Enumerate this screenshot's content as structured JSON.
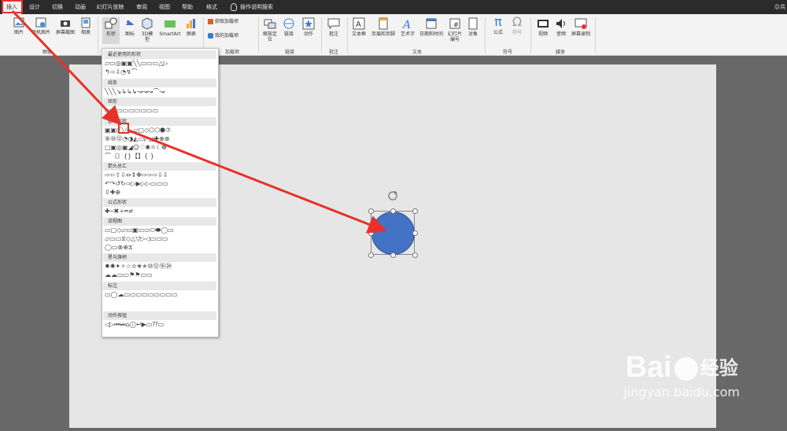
{
  "tabs": [
    {
      "label": "插入",
      "active": true
    },
    {
      "label": "设计"
    },
    {
      "label": "切换"
    },
    {
      "label": "动画"
    },
    {
      "label": "幻灯片放映"
    },
    {
      "label": "审阅"
    },
    {
      "label": "视图"
    },
    {
      "label": "帮助"
    },
    {
      "label": "格式"
    }
  ],
  "tell_me": "操作说明搜索",
  "user_label": "共",
  "ribbon": {
    "images": {
      "picture": "图片",
      "online_picture": "联机图片",
      "screenshot": "屏幕截图",
      "album": "相册",
      "group": "图像"
    },
    "illustrations": {
      "shapes": "形状",
      "icons": "图标",
      "model3d": "3D模型",
      "smartart": "SmartArt",
      "chart": "图表"
    },
    "addins": {
      "get": "获取加载项",
      "my": "我的加载项",
      "group": "加载项"
    },
    "links": {
      "zoom": "缩放定位",
      "link": "链接",
      "action": "动作",
      "group": "链接"
    },
    "comments": {
      "comment": "批注",
      "group": "批注"
    },
    "text": {
      "textbox": "文本框",
      "header_footer": "页眉和页脚",
      "wordart": "艺术字",
      "datetime": "日期和时间",
      "slide_number": "幻灯片编号",
      "object": "对象",
      "group": "文本"
    },
    "symbols": {
      "equation": "公式",
      "symbol": "符号",
      "group": "符号"
    },
    "media": {
      "video": "视频",
      "audio": "音频",
      "screen_recording": "屏幕录制",
      "group": "媒体"
    }
  },
  "gallery": {
    "recent": "最近使用的形状",
    "lines": "线条",
    "rectangles": "矩形",
    "basic": "基本形状",
    "arrows": "箭头总汇",
    "equation": "公式形状",
    "flowchart": "流程图",
    "stars": "星与旗帜",
    "callouts": "标注",
    "action": "动作按钮"
  },
  "shape_fill": "#4472c4",
  "annotation_color": "#e8312a",
  "watermark": {
    "brand": "Bai",
    "brand2": "经验",
    "url": "jingyan.baidu.com"
  }
}
